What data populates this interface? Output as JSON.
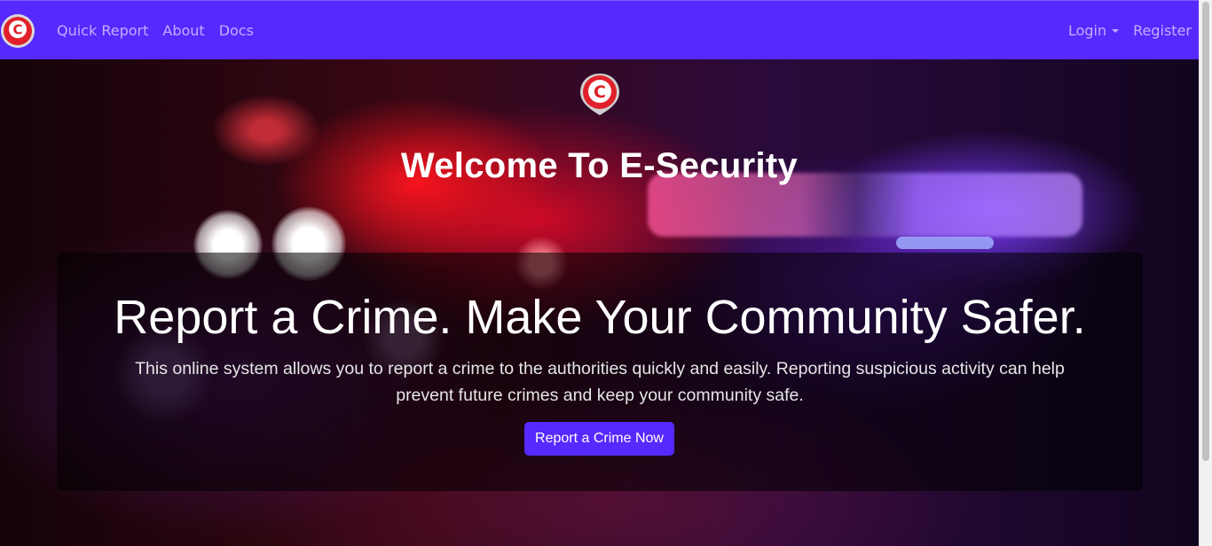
{
  "navbar": {
    "brand_icon": "crime-location-pin-icon",
    "links": [
      "Quick Report",
      "About",
      "Docs"
    ],
    "login_label": "Login",
    "register_label": "Register"
  },
  "hero": {
    "logo_icon": "crime-location-pin-icon",
    "welcome": "Welcome To E-Security",
    "tagline": "Report a Crime. Make Your Community Safer.",
    "description": "This online system allows you to report a crime to the authorities quickly and easily. Reporting suspicious activity can help prevent future crimes and keep your community safe.",
    "cta_label": "Report a Crime Now"
  },
  "colors": {
    "navbar": "#5629ff",
    "button": "#5629ff",
    "logo_red": "#e0202a"
  }
}
